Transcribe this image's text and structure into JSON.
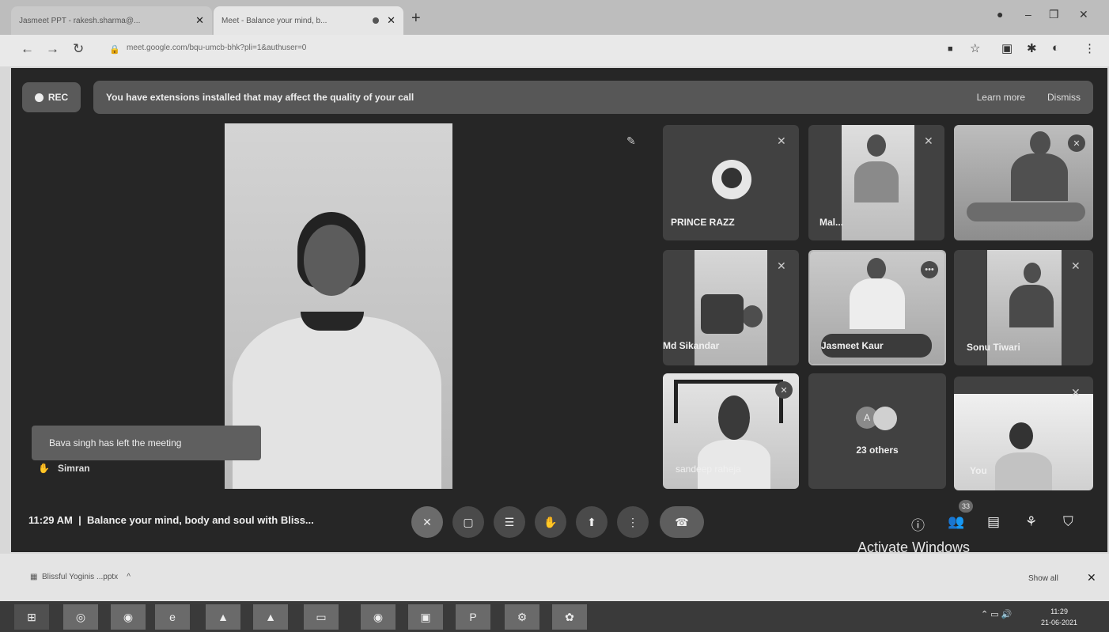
{
  "browser": {
    "tabs": [
      {
        "label": "Jasmeet PPT - rakesh.sharma@..."
      },
      {
        "label": "Meet - Balance your mind, b..."
      }
    ],
    "url": "meet.google.com/bqu-umcb-bhk?pli=1&authuser=0"
  },
  "meet": {
    "rec_label": "REC",
    "banner_text": "You have extensions installed that may affect the quality of your call",
    "learn_more": "Learn more",
    "dismiss": "Dismiss",
    "toast": "Bava singh has left the meeting",
    "presenter_name": "Simran",
    "time": "11:29 AM",
    "separator": "|",
    "meeting_title": "Balance your mind, body and soul with Bliss...",
    "participants": [
      {
        "name": "PRINCE RAZZ"
      },
      {
        "name": "Mal..."
      },
      {
        "name": ""
      },
      {
        "name": "Md Sikandar"
      },
      {
        "name": "Jasmeet Kaur"
      },
      {
        "name": "Sonu Tiwari"
      },
      {
        "name": "sandeep raheja"
      },
      {
        "name": "23 others"
      },
      {
        "name": "You"
      }
    ],
    "others_avatar": "A",
    "people_count": "33"
  },
  "os": {
    "activate_text": "Activate Windows",
    "download_file": "Blissful Yoginis ...pptx",
    "show_all": "Show all",
    "clock_time": "11:29",
    "clock_date": "21-06-2021"
  }
}
